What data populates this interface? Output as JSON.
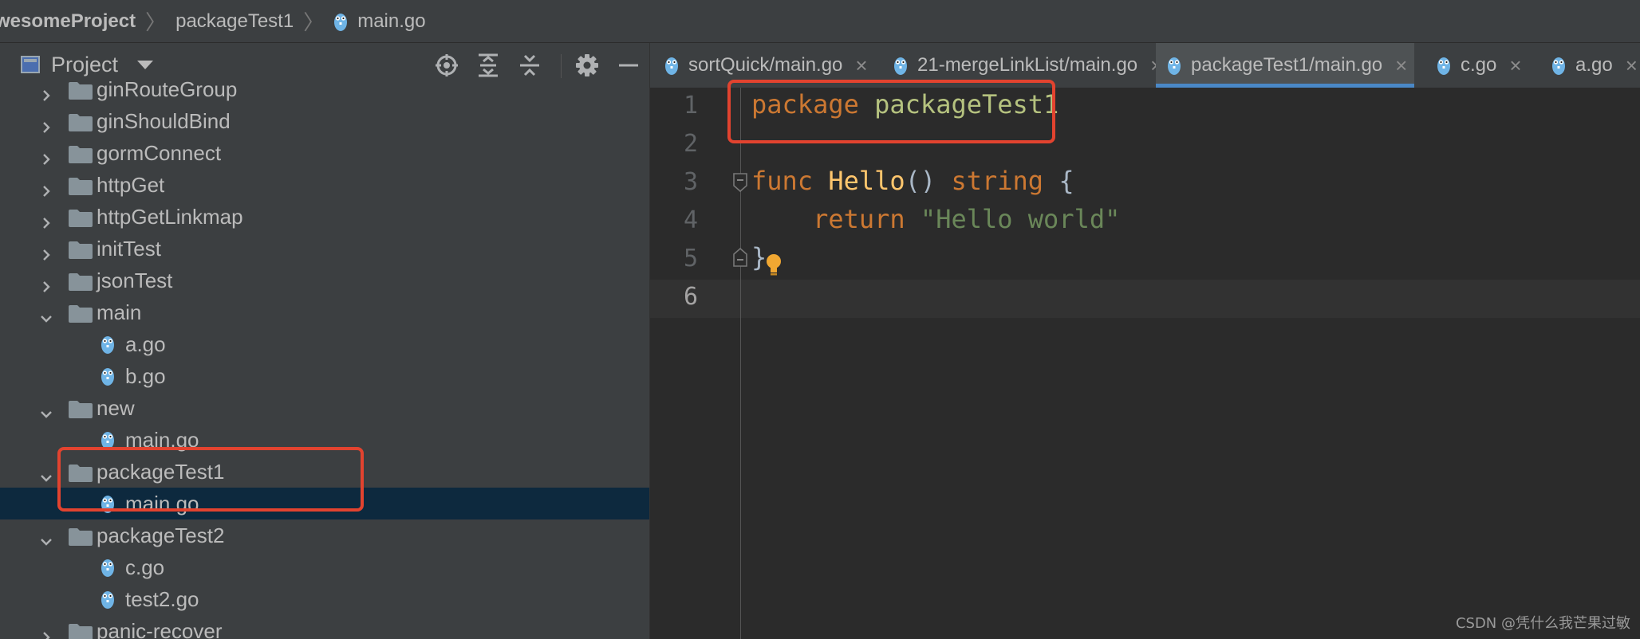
{
  "breadcrumb": {
    "project": "wesomeProject",
    "folder": "packageTest1",
    "file": "main.go"
  },
  "project_panel": {
    "title": "Project",
    "toolbar_icons": [
      "locate-icon",
      "expand-all-icon",
      "collapse-all-icon",
      "gear-icon",
      "minimize-icon"
    ]
  },
  "tree": {
    "items": [
      {
        "label": "ginRouteGroup",
        "type": "folder",
        "expanded": false
      },
      {
        "label": "ginShouldBind",
        "type": "folder",
        "expanded": false
      },
      {
        "label": "gormConnect",
        "type": "folder",
        "expanded": false
      },
      {
        "label": "httpGet",
        "type": "folder",
        "expanded": false
      },
      {
        "label": "httpGetLinkmap",
        "type": "folder",
        "expanded": false
      },
      {
        "label": "initTest",
        "type": "folder",
        "expanded": false
      },
      {
        "label": "jsonTest",
        "type": "folder",
        "expanded": false
      },
      {
        "label": "main",
        "type": "folder",
        "expanded": true
      },
      {
        "label": "a.go",
        "type": "file"
      },
      {
        "label": "b.go",
        "type": "file"
      },
      {
        "label": "new",
        "type": "folder",
        "expanded": true
      },
      {
        "label": "main.go",
        "type": "file"
      },
      {
        "label": "packageTest1",
        "type": "folder",
        "expanded": true
      },
      {
        "label": "main.go",
        "type": "file",
        "selected": true
      },
      {
        "label": "packageTest2",
        "type": "folder",
        "expanded": true
      },
      {
        "label": "c.go",
        "type": "file"
      },
      {
        "label": "test2.go",
        "type": "file"
      },
      {
        "label": "panic-recover",
        "type": "folder",
        "expanded": false
      }
    ]
  },
  "tabs": [
    {
      "label": "sortQuick/main.go",
      "active": false
    },
    {
      "label": "21-mergeLinkList/main.go",
      "active": false
    },
    {
      "label": "packageTest1/main.go",
      "active": true
    },
    {
      "label": "c.go",
      "active": false
    },
    {
      "label": "a.go",
      "active": false
    }
  ],
  "editor": {
    "line_numbers": [
      "1",
      "2",
      "3",
      "4",
      "5",
      "6"
    ],
    "current_line": 6,
    "code": {
      "l1_kw": "package",
      "l1_name": "packageTest1",
      "l3_kw": "func",
      "l3_fn": "Hello",
      "l3_parens": "()",
      "l3_type": "string",
      "l3_brace": "{",
      "l4_kw": "return",
      "l4_str": "\"Hello world\"",
      "l5_brace": "}"
    }
  },
  "watermark": "CSDN @凭什么我芒果过敏",
  "colors": {
    "accent": "#4a88c7",
    "highlight_box": "#e2432f",
    "keyword": "#cc7832",
    "function": "#ffc66d",
    "string": "#6a8759",
    "selection": "#0d293e"
  }
}
